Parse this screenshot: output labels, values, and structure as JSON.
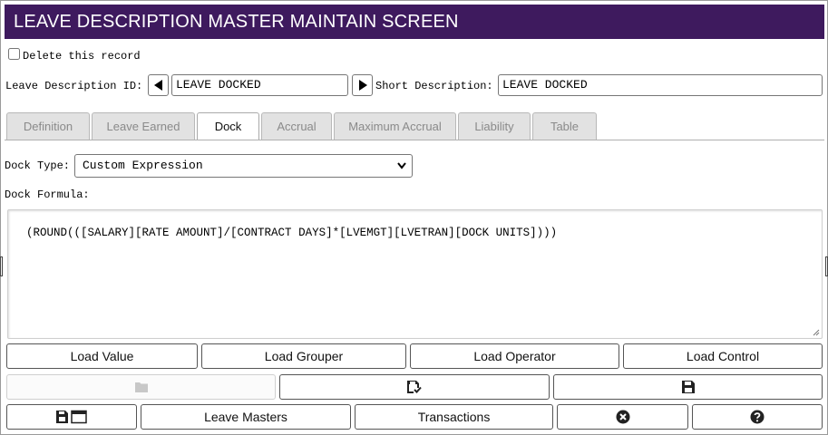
{
  "window": {
    "title": "LEAVE DESCRIPTION MASTER MAINTAIN SCREEN"
  },
  "record": {
    "delete_label": "Delete this record",
    "delete_checked": false,
    "id_label": "Leave Description ID:",
    "id_value": "LEAVE DOCKED",
    "short_label": "Short Description:",
    "short_value": "LEAVE DOCKED"
  },
  "tabs": [
    {
      "label": "Definition",
      "active": false
    },
    {
      "label": "Leave Earned",
      "active": false
    },
    {
      "label": "Dock",
      "active": true
    },
    {
      "label": "Accrual",
      "active": false
    },
    {
      "label": "Maximum Accrual",
      "active": false
    },
    {
      "label": "Liability",
      "active": false
    },
    {
      "label": "Table",
      "active": false
    }
  ],
  "dock": {
    "type_label": "Dock Type:",
    "type_value": "Custom Expression",
    "formula_label": "Dock Formula:",
    "formula_value": "(ROUND(([SALARY][RATE AMOUNT]/[CONTRACT DAYS]*[LVEMGT][LVETRAN][DOCK UNITS])))"
  },
  "load_buttons": {
    "value": "Load Value",
    "grouper": "Load Grouper",
    "operator": "Load Operator",
    "control": "Load Control"
  },
  "toolbar": {
    "open_icon": "folder-icon",
    "save_check_icon": "floppy-check-icon",
    "save_icon": "floppy-icon"
  },
  "bottom": {
    "save_window_icon": "floppy-window-icon",
    "leave_masters": "Leave Masters",
    "transactions": "Transactions",
    "close_icon": "close-circle-icon",
    "help_icon": "help-circle-icon"
  },
  "colors": {
    "title_bg": "#3e1a5e",
    "title_fg": "#ffffff"
  }
}
